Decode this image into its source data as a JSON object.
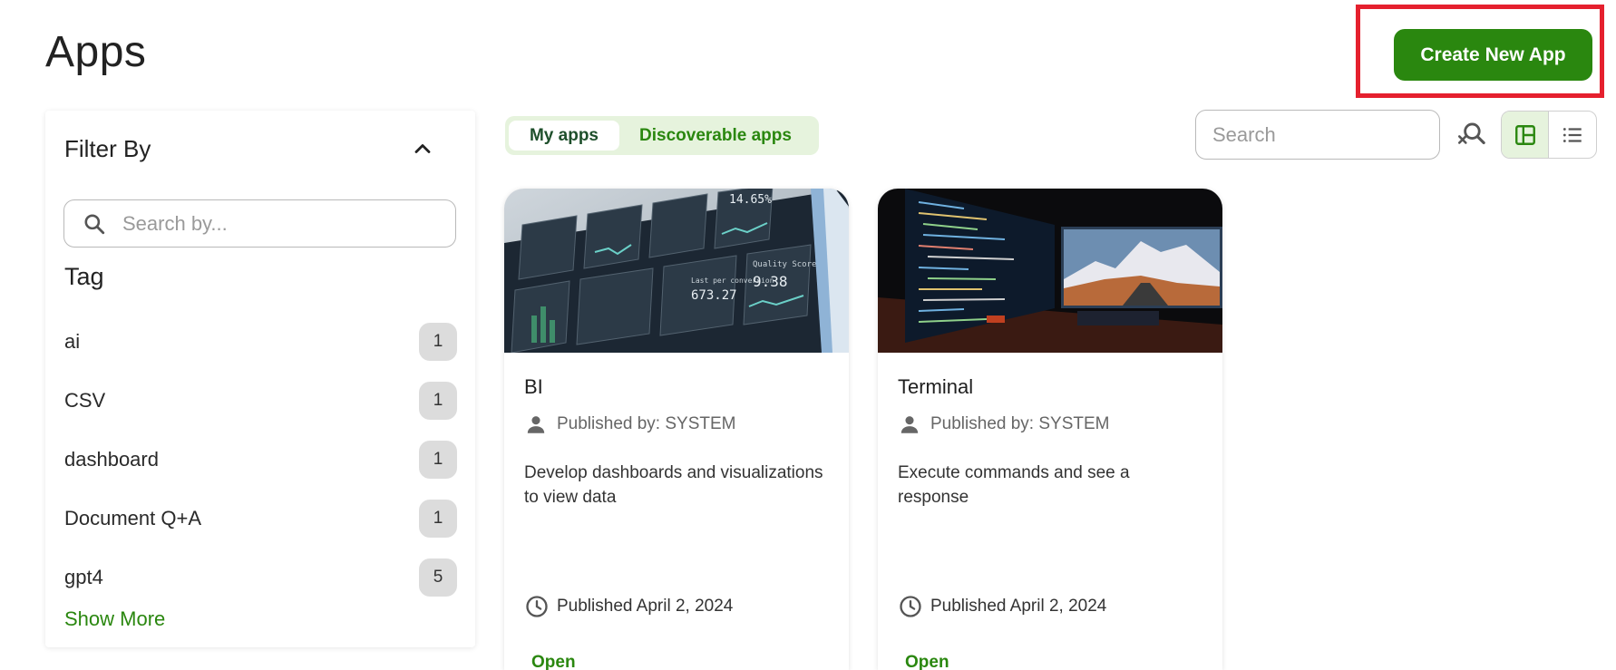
{
  "page": {
    "title": "Apps"
  },
  "header": {
    "create_button": "Create New App"
  },
  "filter": {
    "title": "Filter By",
    "search_placeholder": "Search by...",
    "tag_heading": "Tag",
    "tags": [
      {
        "label": "ai",
        "count": "1"
      },
      {
        "label": "CSV",
        "count": "1"
      },
      {
        "label": "dashboard",
        "count": "1"
      },
      {
        "label": "Document Q+A",
        "count": "1"
      },
      {
        "label": "gpt4",
        "count": "5"
      }
    ],
    "show_more": "Show More"
  },
  "tabs": [
    {
      "label": "My apps",
      "active": true
    },
    {
      "label": "Discoverable apps",
      "active": false
    }
  ],
  "toolbar": {
    "search_placeholder": "Search",
    "views": [
      "grid-view-icon",
      "list-view-icon"
    ],
    "active_view": "grid"
  },
  "cards": [
    {
      "title": "BI",
      "publisher": "Published by: SYSTEM",
      "description": "Develop dashboards and visualizations to view data",
      "date": "Published April 2, 2024",
      "action": "Open",
      "image_labels": [
        "14.65%",
        "Quality Score",
        "9.38",
        "673.27",
        "Last per conversion"
      ]
    },
    {
      "title": "Terminal",
      "publisher": "Published by: SYSTEM",
      "description": "Execute commands and see a response",
      "date": "Published April 2, 2024",
      "action": "Open"
    }
  ],
  "colors": {
    "brand_green": "#2a870f",
    "tab_bg": "#e6f3dd",
    "highlight_red": "#e5202e",
    "badge_gray": "#dcdcdc"
  }
}
